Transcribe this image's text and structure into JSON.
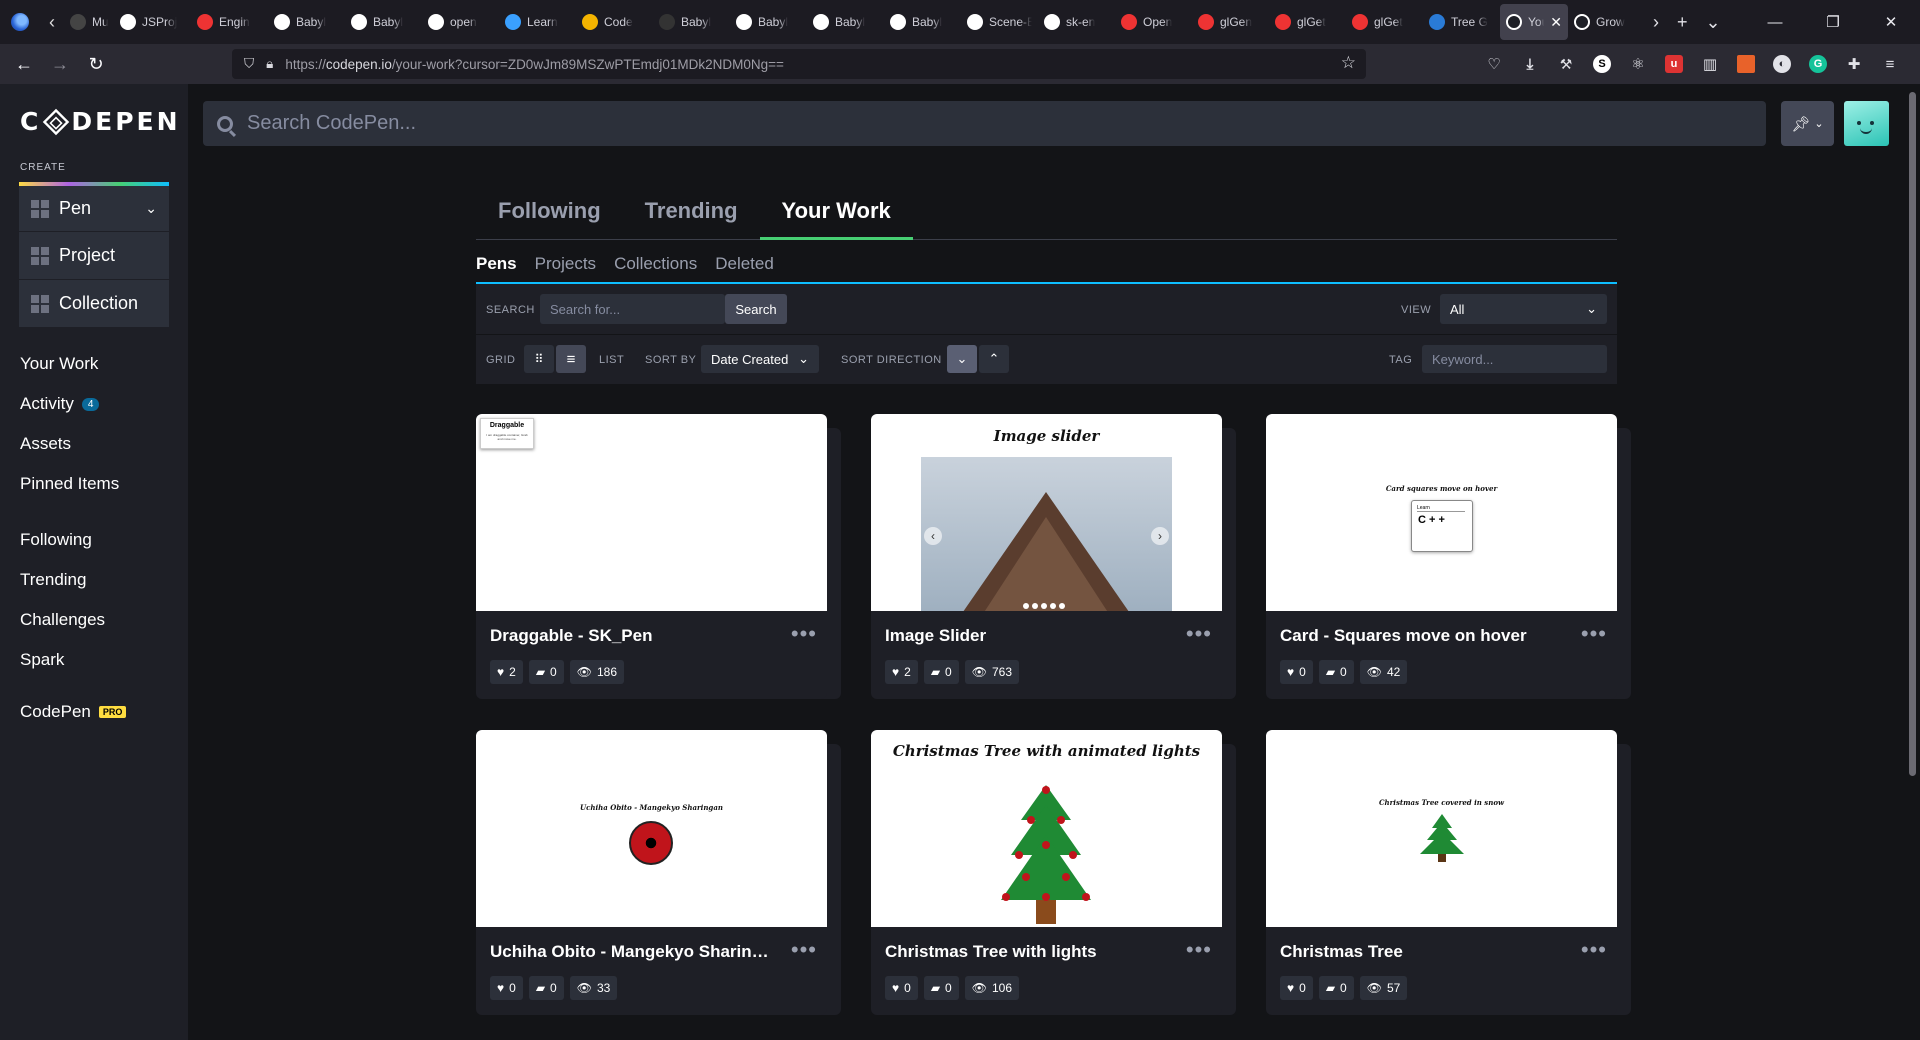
{
  "browser": {
    "tabs": [
      {
        "label": "Music"
      },
      {
        "label": "JSProj"
      },
      {
        "label": "Engin"
      },
      {
        "label": "Babyl"
      },
      {
        "label": "Babyl"
      },
      {
        "label": "open"
      },
      {
        "label": "Learn"
      },
      {
        "label": "Code"
      },
      {
        "label": "Babyl"
      },
      {
        "label": "Babyl"
      },
      {
        "label": "Babyl"
      },
      {
        "label": "Babyl"
      },
      {
        "label": "Scene-Eng"
      },
      {
        "label": "sk-en"
      },
      {
        "label": "Open"
      },
      {
        "label": "glGen"
      },
      {
        "label": "glGet"
      },
      {
        "label": "glGet"
      },
      {
        "label": "Tree G"
      }
    ],
    "active_tab": "You",
    "after_tab": "Grow",
    "url_prefix": "https://",
    "url_host": "codepen.io",
    "url_path": "/your-work?cursor=ZD0wJm89MSZwPTEmdj01MDk2NDM0Ng=="
  },
  "sidebar": {
    "logo": "CODEPEN",
    "create_label": "CREATE",
    "create_items": [
      "Pen",
      "Project",
      "Collection"
    ],
    "nav1": [
      {
        "label": "Your Work"
      },
      {
        "label": "Activity",
        "count": "4"
      },
      {
        "label": "Assets"
      },
      {
        "label": "Pinned Items"
      }
    ],
    "nav2": [
      "Following",
      "Trending",
      "Challenges",
      "Spark"
    ],
    "pro_link": "CodePen",
    "pro_badge": "PRO"
  },
  "header": {
    "search_placeholder": "Search CodePen..."
  },
  "main": {
    "tabs": [
      "Following",
      "Trending",
      "Your Work"
    ],
    "subtabs": [
      "Pens",
      "Projects",
      "Collections",
      "Deleted"
    ],
    "filter": {
      "search_label": "SEARCH",
      "search_placeholder": "Search for...",
      "search_button": "Search",
      "view_label": "VIEW",
      "view_value": "All",
      "grid_label": "GRID",
      "list_label": "LIST",
      "sort_by_label": "SORT BY",
      "sort_by_value": "Date Created",
      "sort_dir_label": "SORT DIRECTION",
      "tag_label": "TAG",
      "tag_placeholder": "Keyword..."
    }
  },
  "pens": [
    {
      "title": "Draggable - SK_Pen",
      "likes": "2",
      "comments": "0",
      "views": "186",
      "preview_title": "Draggable",
      "preview_sub": "I am draggable container, Grab and move me."
    },
    {
      "title": "Image Slider",
      "likes": "2",
      "comments": "0",
      "views": "763",
      "preview_title": "Image slider"
    },
    {
      "title": "Card - Squares move on hover",
      "likes": "0",
      "comments": "0",
      "views": "42",
      "preview_title": "Card squares move on hover",
      "preview_card_label": "Learn",
      "preview_card_text": "C + +"
    },
    {
      "title": "Uchiha Obito - Mangekyo Sharingan",
      "likes": "0",
      "comments": "0",
      "views": "33",
      "preview_title": "Uchiha Obito - Mangekyo Sharingan"
    },
    {
      "title": "Christmas Tree with lights",
      "likes": "0",
      "comments": "0",
      "views": "106",
      "preview_title": "Christmas Tree with animated lights"
    },
    {
      "title": "Christmas Tree",
      "likes": "0",
      "comments": "0",
      "views": "57",
      "preview_title": "Christmas Tree covered in snow"
    }
  ]
}
